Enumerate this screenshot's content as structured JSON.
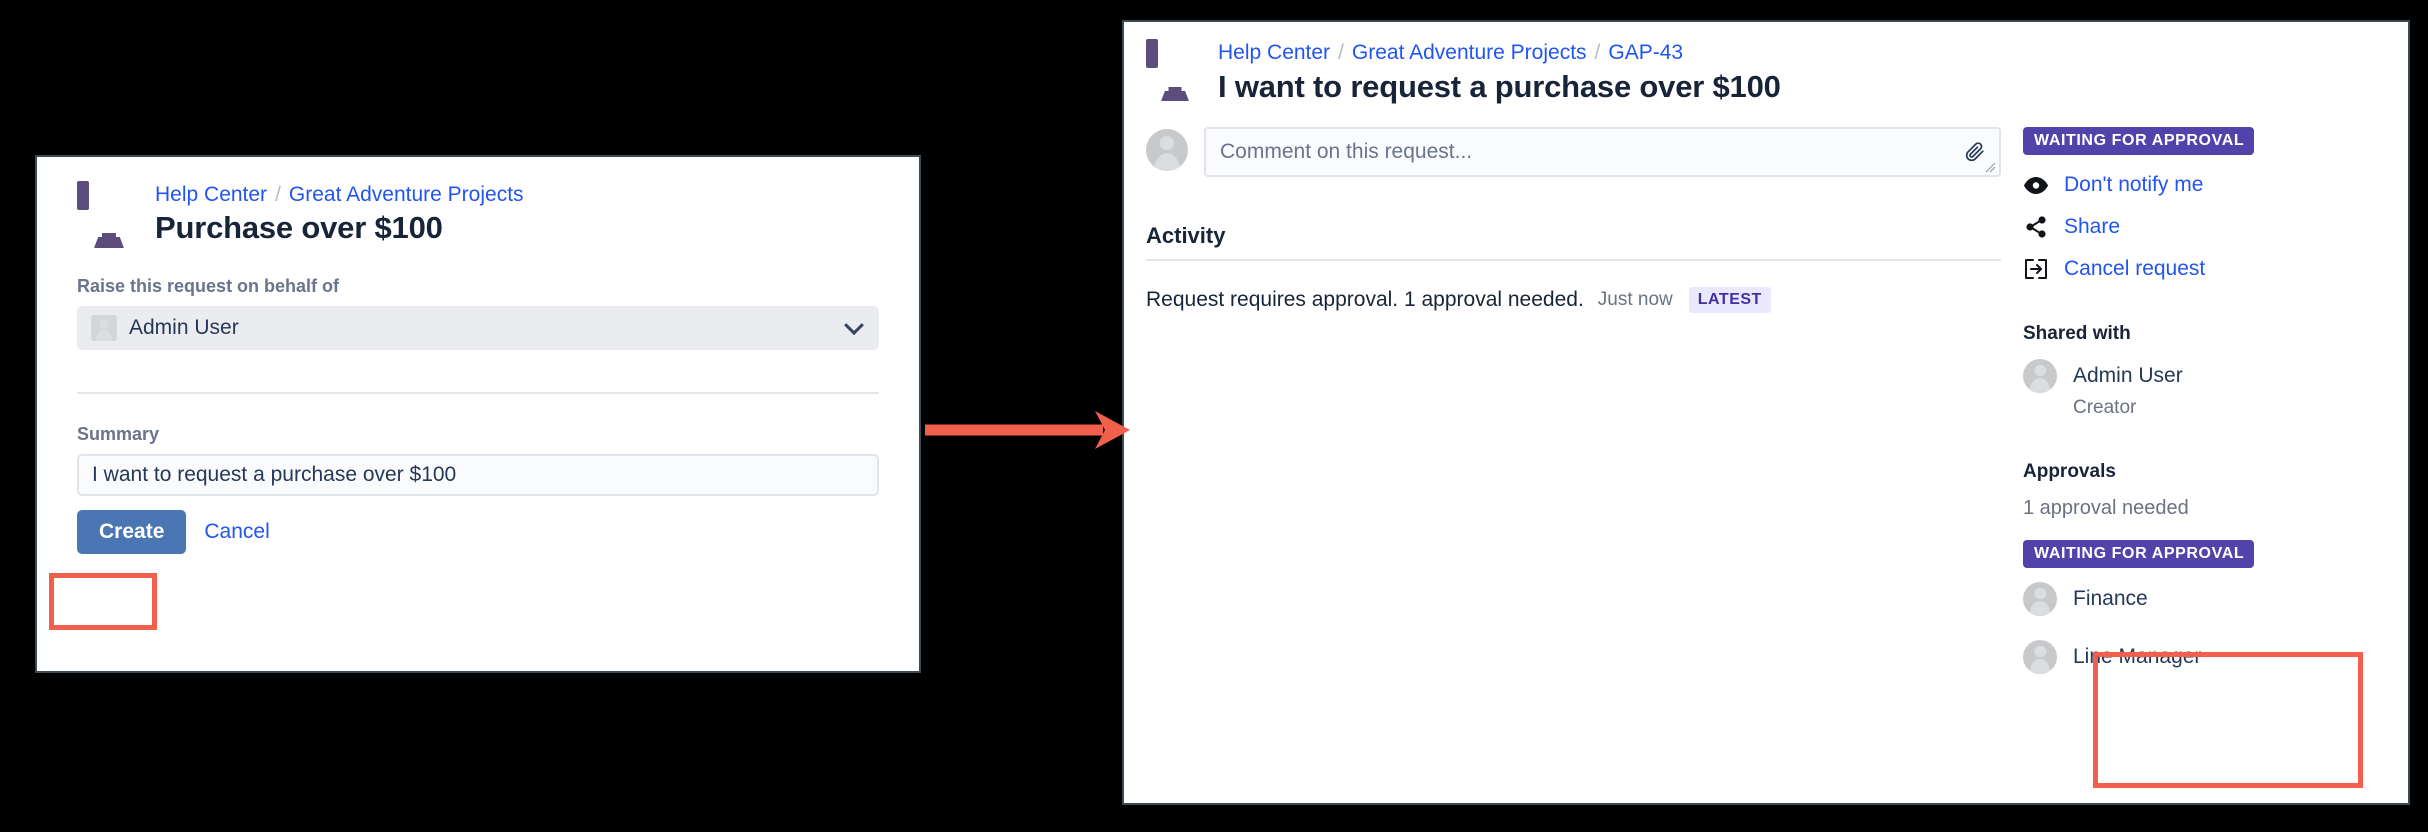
{
  "left_panel": {
    "icon": "monitor-icon",
    "breadcrumbs": [
      {
        "label": "Help Center"
      },
      {
        "label": "Great Adventure Projects"
      }
    ],
    "separator": "/",
    "title": "Purchase over $100",
    "behalf_field": {
      "label": "Raise this request on behalf of",
      "value": "Admin User",
      "chevron": "chevron-down-icon"
    },
    "summary_field": {
      "label": "Summary",
      "value": "I want to request a purchase over $100"
    },
    "create_label": "Create",
    "cancel_label": "Cancel"
  },
  "right_panel": {
    "icon": "monitor-icon",
    "breadcrumbs": [
      {
        "label": "Help Center"
      },
      {
        "label": "Great Adventure Projects"
      },
      {
        "label": "GAP-43"
      }
    ],
    "separator": "/",
    "title": "I want to request a purchase over $100",
    "comment": {
      "placeholder": "Comment on this request...",
      "attach_icon": "paperclip-icon"
    },
    "activity": {
      "heading": "Activity",
      "items": [
        {
          "text": "Request requires approval. 1 approval needed.",
          "time": "Just now",
          "badge": "LATEST"
        }
      ]
    },
    "sidebar": {
      "status": "WAITING FOR APPROVAL",
      "actions": [
        {
          "icon": "eye-icon",
          "label": "Don't notify me"
        },
        {
          "icon": "share-icon",
          "label": "Share"
        },
        {
          "icon": "cancel-request-icon",
          "label": "Cancel request"
        }
      ],
      "shared_with": {
        "heading": "Shared with",
        "people": [
          {
            "name": "Admin User",
            "role": "Creator"
          }
        ]
      },
      "approvals": {
        "heading": "Approvals",
        "note": "1 approval needed",
        "status": "WAITING FOR APPROVAL",
        "approvers": [
          {
            "name": "Finance"
          },
          {
            "name": "Line Manager"
          }
        ]
      }
    }
  },
  "annotations": {
    "arrow": "flow-arrow",
    "highlight_color": "#f0604d"
  },
  "colors": {
    "link": "#2255ee",
    "primary_button": "#4a77b4",
    "status_purple": "#5243aa",
    "monitor_purple": "#5c4d7d",
    "highlight": "#f0604d"
  }
}
